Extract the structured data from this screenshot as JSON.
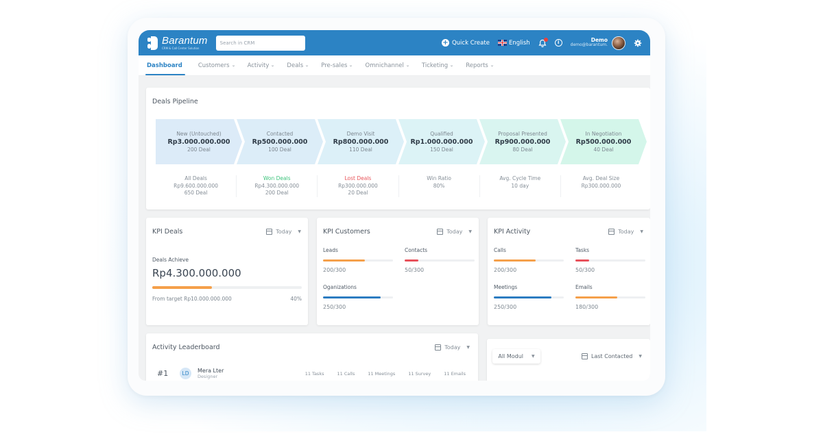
{
  "app": {
    "logo_name": "Barantum",
    "logo_tagline": "CRM & Call Center Solution",
    "search_placeholder": "Search in CRM",
    "quick_create": "Quick Create",
    "language": "English",
    "user_name": "Demo",
    "user_email": "demo@barantum."
  },
  "nav": {
    "items": [
      {
        "label": "Dashboard",
        "active": true
      },
      {
        "label": "Customers"
      },
      {
        "label": "Activity"
      },
      {
        "label": "Deals"
      },
      {
        "label": "Pre-sales"
      },
      {
        "label": "Omnichannel"
      },
      {
        "label": "Ticketing"
      },
      {
        "label": "Reports"
      }
    ]
  },
  "pipeline": {
    "title": "Deals Pipeline",
    "stages": [
      {
        "name": "New (Untouched)",
        "amount": "Rp3.000.000.000",
        "count": "200 Deal",
        "color": "#dcebf8"
      },
      {
        "name": "Contacted",
        "amount": "Rp500.000.000",
        "count": "100 Deal",
        "color": "#dcedf8"
      },
      {
        "name": "Demo Visit",
        "amount": "Rp800.000.000",
        "count": "110 Deal",
        "color": "#dcf0f8"
      },
      {
        "name": "Qualified",
        "amount": "Rp1.000.000.000",
        "count": "150 Deal",
        "color": "#dcf3f6"
      },
      {
        "name": "Proposal Presented",
        "amount": "Rp900.000.000",
        "count": "80 Deal",
        "color": "#d9f5f0"
      },
      {
        "name": "In Negotiation",
        "amount": "Rp500.000.000",
        "count": "40 Deal",
        "color": "#d4f6ea"
      }
    ],
    "stats": [
      {
        "label": "All Deals",
        "value": "Rp9.600.000.000",
        "sub": "650 Deal",
        "tone": ""
      },
      {
        "label": "Won Deals",
        "value": "Rp4.300.000.000",
        "sub": "200 Deal",
        "tone": "green"
      },
      {
        "label": "Lost Deals",
        "value": "Rp300.000.000",
        "sub": "20 Deal",
        "tone": "red"
      },
      {
        "label": "Win Ratio",
        "value": "80%",
        "sub": "",
        "tone": ""
      },
      {
        "label": "Avg. Cycle Time",
        "value": "10 day",
        "sub": "",
        "tone": ""
      },
      {
        "label": "Avg. Deal Size",
        "value": "Rp300.000.000",
        "sub": "",
        "tone": ""
      }
    ]
  },
  "kpi_deals": {
    "title": "KPI Deals",
    "period": "Today",
    "label": "Deals Achieve",
    "amount": "Rp4.300.000.000",
    "target": "From target Rp10.000.000.000",
    "percent_label": "40%",
    "progress": 0.4,
    "color": "#f5a04a"
  },
  "kpi_customers": {
    "title": "KPI Customers",
    "period": "Today",
    "metrics": [
      {
        "label": "Leads",
        "value": "200/300",
        "progress": 0.6,
        "color": "#f5a04a"
      },
      {
        "label": "Contacts",
        "value": "50/300",
        "progress": 0.2,
        "color": "#e8505a"
      },
      {
        "label": "Oganizations",
        "value": "250/300",
        "progress": 0.82,
        "color": "#2c7cc1"
      }
    ]
  },
  "kpi_activity": {
    "title": "KPI Activity",
    "period": "Today",
    "metrics": [
      {
        "label": "Calls",
        "value": "200/300",
        "progress": 0.6,
        "color": "#f5a04a"
      },
      {
        "label": "Tasks",
        "value": "50/300",
        "progress": 0.2,
        "color": "#e8505a"
      },
      {
        "label": "Meetings",
        "value": "250/300",
        "progress": 0.82,
        "color": "#2c7cc1"
      },
      {
        "label": "Emails",
        "value": "180/300",
        "progress": 0.6,
        "color": "#f5a04a"
      }
    ]
  },
  "leaderboard": {
    "title": "Activity Leaderboard",
    "period": "Today",
    "rows": [
      {
        "rank": "#1",
        "initials": "LD",
        "name": "Mera Lter",
        "role": "Designer",
        "stats": [
          "11 Tasks",
          "11 Calls",
          "11 Meetings",
          "11 Survey",
          "11 Emails"
        ]
      }
    ]
  },
  "filters": {
    "module": "All Modul",
    "sort": "Last Contacted"
  }
}
